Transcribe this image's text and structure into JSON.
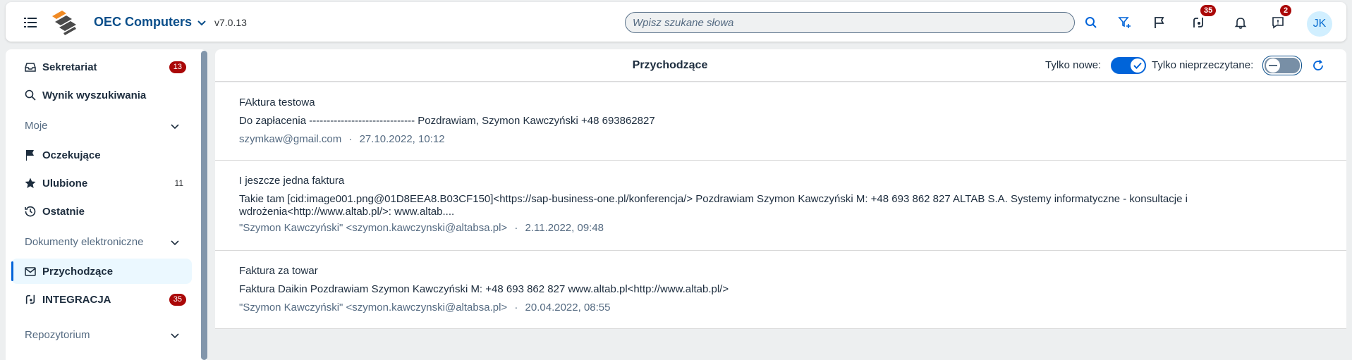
{
  "header": {
    "app_name": "OEC Computers",
    "version": "v7.0.13",
    "search_placeholder": "Wpisz szukane słowa",
    "integration_badge": "35",
    "notifications_badge": "2",
    "avatar_initials": "JK"
  },
  "sidebar": {
    "items": [
      {
        "label": "Sekretariat",
        "count": "13"
      },
      {
        "label": "Wynik wyszukiwania"
      }
    ],
    "sections": [
      {
        "label": "Moje"
      },
      {
        "label": "Dokumenty elektroniczne"
      },
      {
        "label": "Repozytorium"
      }
    ],
    "moje_items": [
      {
        "label": "Oczekujące"
      },
      {
        "label": "Ulubione",
        "count": "11"
      },
      {
        "label": "Ostatnie"
      }
    ],
    "dokumenty_items": [
      {
        "label": "Przychodzące"
      },
      {
        "label": "INTEGRACJA",
        "count": "35"
      }
    ]
  },
  "main": {
    "title": "Przychodzące",
    "filter_new_label": "Tylko nowe:",
    "filter_unread_label": "Tylko nieprzeczytane:",
    "filter_new_on": true,
    "filter_unread_on": false,
    "messages": [
      {
        "subject": "FAktura testowa",
        "body": "Do zapłacenia ------------------------------ Pozdrawiam, Szymon Kawczyński +48 693862827",
        "sender": "szymkaw@gmail.com",
        "date": "27.10.2022, 10:12"
      },
      {
        "subject": "I jeszcze jedna faktura",
        "body": "Takie tam [cid:image001.png@01D8EEA8.B03CF150]<https://sap-business-one.pl/konferencja/> Pozdrawiam Szymon Kawczyński M: +48 693 862 827 ALTAB S.A. Systemy informatyczne - konsultacje i wdrożenia<http://www.altab.pl/>: www.altab....",
        "sender": "\"Szymon Kawczyński\" <szymon.kawczynski@altabsa.pl>",
        "date": "2.11.2022, 09:48"
      },
      {
        "subject": "Faktura za towar",
        "body": "Faktura Daikin Pozdrawiam Szymon Kawczyński M: +48 693 862 827 www.altab.pl<http://www.altab.pl/>",
        "sender": "\"Szymon Kawczyński\" <szymon.kawczynski@altabsa.pl>",
        "date": "20.04.2022, 08:55"
      }
    ],
    "meta_separator": "·"
  },
  "colors": {
    "accent": "#0064d9",
    "brand_title": "#0a4e8a",
    "badge": "#aa0808",
    "muted": "#556b82"
  }
}
